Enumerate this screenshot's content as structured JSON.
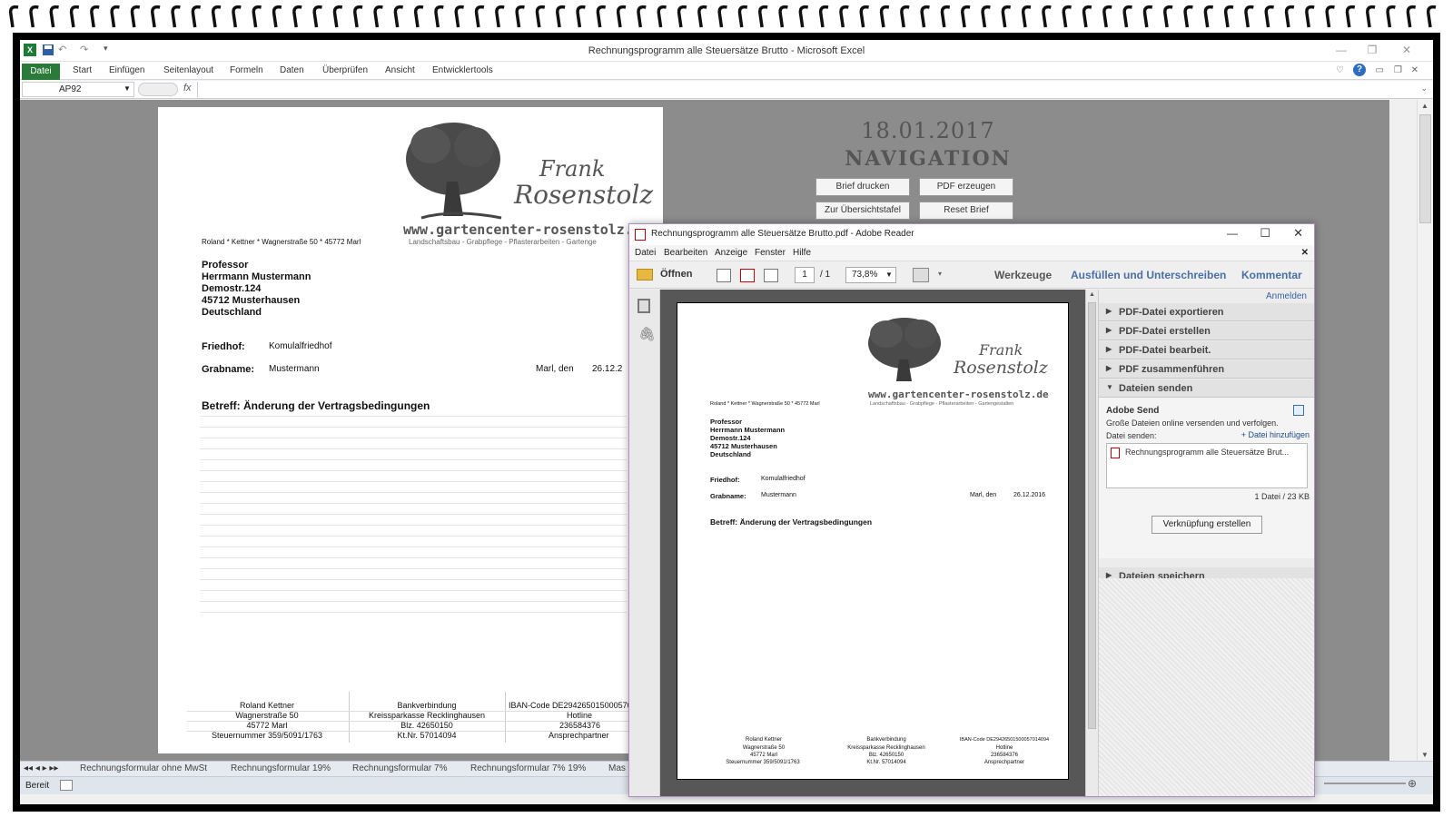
{
  "excel": {
    "window_title": "Rechnungsprogramm alle Steuersätze Brutto  -  Microsoft Excel",
    "ribbon_tabs": [
      "Datei",
      "Start",
      "Einfügen",
      "Seitenlayout",
      "Formeln",
      "Daten",
      "Überprüfen",
      "Ansicht",
      "Entwicklertools"
    ],
    "namebox": "AP92",
    "fx_label": "fx",
    "formula_value": "",
    "letter": {
      "logo_line1": "Frank",
      "logo_line2": "Rosenstolz",
      "website": "www.gartencenter-rosenstolz.",
      "tagline": "Landschaftsbau - Grabpflege - Pflasterarbeiten - Gartenge",
      "sender_line": "Roland  *  Kettner  *  Wagnerstraße 50  *  45772 Marl",
      "recipient": [
        "Professor",
        "Herrmann Mustermann",
        "Demostr.124",
        "45712 Musterhausen",
        "Deutschland"
      ],
      "friedhof_label": "Friedhof:",
      "friedhof_value": "Komulalfriedhof",
      "grabname_label": "Grabname:",
      "grabname_value": "Mustermann",
      "place_date_label": "Marl, den",
      "date_value": "26.12.2",
      "subject": "Betreff:  Änderung der Vertragsbedingungen",
      "footer_col1": [
        "Roland Kettner",
        "Wagnerstraße 50",
        "45772 Marl",
        "Steuernummer 359/5091/1763"
      ],
      "footer_col2": [
        "Bankverbindung",
        "Kreissparkasse Recklinghausen",
        "Blz. 42650150",
        "Kt.Nr. 57014094"
      ],
      "footer_col3": [
        "IBAN-Code DE294265015000570",
        "Hotline",
        "236584376",
        "Ansprechpartner"
      ]
    },
    "nav": {
      "date": "18.01.2017",
      "title": "NAVIGATION",
      "btn_brief_drucken": "Brief drucken",
      "btn_pdf_erzeugen": "PDF erzeugen",
      "btn_uebersicht": "Zur Übersichtstafel",
      "btn_reset": "Reset Brief"
    },
    "sheet_tabs": [
      "Rechnungsformular ohne MwSt",
      "Rechnungsformular 19%",
      "Rechnungsformular 7%",
      "Rechnungsformular 7% 19%",
      "Mas"
    ],
    "status": "Bereit"
  },
  "reader": {
    "window_title": "Rechnungsprogramm alle Steuersätze Brutto.pdf - Adobe Reader",
    "menu": [
      "Datei",
      "Bearbeiten",
      "Anzeige",
      "Fenster",
      "Hilfe"
    ],
    "open_label": "Öffnen",
    "page_current": "1",
    "page_total": "/  1",
    "zoom": "73,8%",
    "werkzeuge": "Werkzeuge",
    "fill_sign": "Ausfüllen und Unterschreiben",
    "comment": "Kommentar",
    "signin": "Anmelden",
    "panels": [
      "PDF-Datei exportieren",
      "PDF-Datei erstellen",
      "PDF-Datei bearbeit.",
      "PDF zusammenführen",
      "Dateien senden",
      "Dateien speichern"
    ],
    "adobe_send_title": "Adobe Send",
    "adobe_send_desc": "Große Dateien online versenden und verfolgen.",
    "datei_senden_label": "Datei senden:",
    "add_file": "+ Datei hinzufügen",
    "file_item": "Rechnungsprogramm alle Steuersätze Brut...",
    "file_count": "1 Datei / 23 KB",
    "create_link_button": "Verknüpfung erstellen",
    "pdf": {
      "logo_line1": "Frank",
      "logo_line2": "Rosenstolz",
      "website": "www.gartencenter-rosenstolz.de",
      "tagline": "Landschaftsbau - Grabpflege - Pflasterarbeiten - Gartengestalten",
      "sender_line": "Roland  *  Kettner  *  Wagnerstraße 50  *  45772 Marl",
      "recipient": [
        "Professor",
        "Herrmann Mustermann",
        "Demostr.124",
        "45712 Musterhausen",
        "Deutschland"
      ],
      "friedhof_label": "Friedhof:",
      "friedhof_value": "Komulalfriedhof",
      "grabname_label": "Grabname:",
      "grabname_value": "Mustermann",
      "place_date_label": "Marl, den",
      "date_value": "26.12.2016",
      "subject": "Betreff:  Änderung der Vertragsbedingungen",
      "footer_col1": [
        "Roland Kettner",
        "Wagnerstraße 50",
        "45772 Marl",
        "Steuernummer 359/5091/1763"
      ],
      "footer_col2": [
        "Bankverbindung",
        "Kreissparkasse Recklinghausen",
        "Blz. 42650150",
        "Kt.Nr. 57014094"
      ],
      "footer_col3": [
        "IBAN-Code DE29426501500057014094",
        "Hotline",
        "236584376",
        "Ansprechpartner"
      ]
    }
  },
  "colors": {
    "excel_green": "#2b7a3a",
    "reader_blue": "#4a6ea8",
    "grid_gray": "#8c8c8c"
  }
}
